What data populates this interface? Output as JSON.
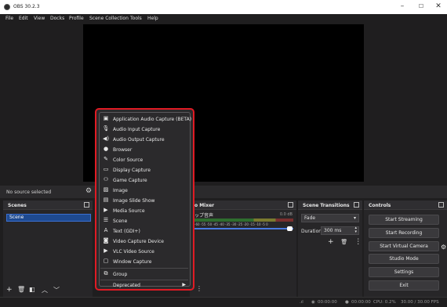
{
  "window": {
    "title": "OBS 30.2.3",
    "minimize": "–",
    "maximize": "☐",
    "close": "✕"
  },
  "menubar": [
    "File",
    "Edit",
    "View",
    "Docks",
    "Profile",
    "Scene Collection",
    "Tools",
    "Help"
  ],
  "sources": {
    "status": "No source selected"
  },
  "scenes": {
    "title": "Scenes",
    "items": [
      "Scene"
    ]
  },
  "mixer": {
    "title": "o Mixer",
    "track": "ップ音声",
    "db": "0.0 dB",
    "scale": "-60 -55 -50 -45 -40 -35 -30 -25 -20 -15 -10 -5 0"
  },
  "transitions": {
    "title": "Scene Transitions",
    "selected": "Fade",
    "duration_label": "Duration",
    "duration_value": "300 ms"
  },
  "controls": {
    "title": "Controls",
    "buttons": [
      "Start Streaming",
      "Start Recording",
      "Start Virtual Camera",
      "Studio Mode",
      "Settings",
      "Exit"
    ]
  },
  "statusbar": {
    "stream_time": "00:00:00",
    "rec_time": "00:00:00",
    "cpu": "CPU: 0.2%",
    "fps": "30.00 / 30.00 FPS"
  },
  "context_menu": {
    "items": [
      {
        "label": "Application Audio Capture (BETA)",
        "icon": "app-audio-icon"
      },
      {
        "label": "Audio Input Capture",
        "icon": "microphone-icon"
      },
      {
        "label": "Audio Output Capture",
        "icon": "speaker-icon"
      },
      {
        "label": "Browser",
        "icon": "globe-icon"
      },
      {
        "label": "Color Source",
        "icon": "brush-icon"
      },
      {
        "label": "Display Capture",
        "icon": "monitor-icon"
      },
      {
        "label": "Game Capture",
        "icon": "gamepad-icon"
      },
      {
        "label": "Image",
        "icon": "image-icon"
      },
      {
        "label": "Image Slide Show",
        "icon": "slideshow-icon"
      },
      {
        "label": "Media Source",
        "icon": "play-icon"
      },
      {
        "label": "Scene",
        "icon": "list-icon"
      },
      {
        "label": "Text (GDI+)",
        "icon": "text-icon"
      },
      {
        "label": "Video Capture Device",
        "icon": "camera-icon"
      },
      {
        "label": "VLC Video Source",
        "icon": "play-icon"
      },
      {
        "label": "Window Capture",
        "icon": "window-icon"
      },
      {
        "label": "Group",
        "icon": "group-icon"
      },
      {
        "label": "Deprecated",
        "icon": "",
        "submenu": true
      }
    ]
  },
  "colors": {
    "highlight_border": "#e01b24",
    "selection": "#1e4a91",
    "background": "#1f1e1f"
  }
}
